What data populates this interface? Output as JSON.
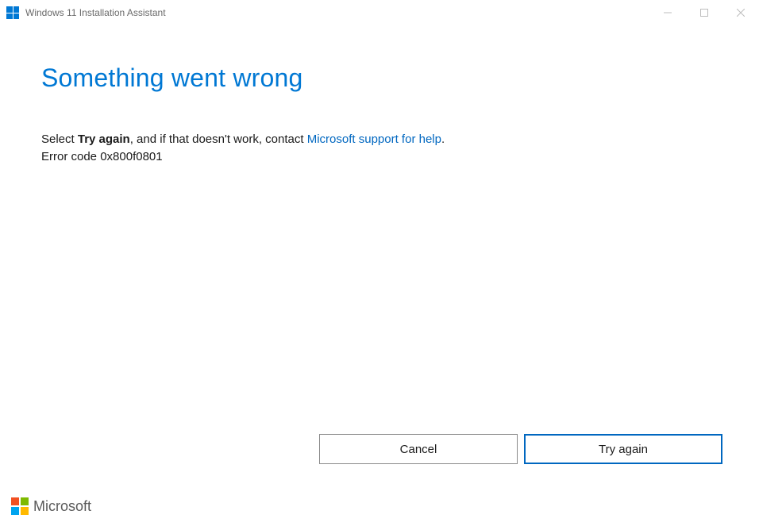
{
  "window": {
    "title": "Windows 11 Installation Assistant"
  },
  "main": {
    "heading": "Something went wrong",
    "body": {
      "prefix": "Select ",
      "bold": "Try again",
      "middle": ", and if that doesn't work, contact ",
      "link_text": "Microsoft support for help",
      "suffix": "."
    },
    "error_code": "Error code 0x800f0801"
  },
  "buttons": {
    "cancel": "Cancel",
    "try_again": "Try again"
  },
  "footer": {
    "brand": "Microsoft"
  }
}
